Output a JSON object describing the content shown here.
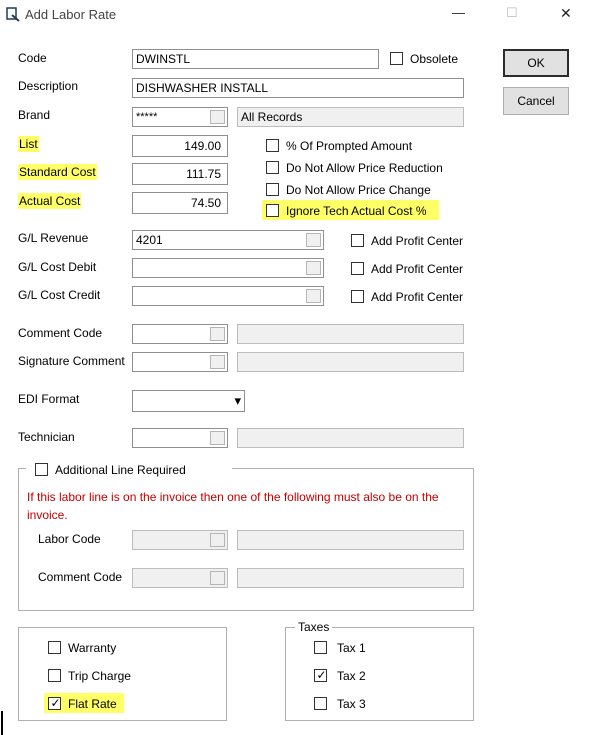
{
  "window": {
    "title": "Add Labor Rate",
    "controls": {
      "minimize": "—",
      "maximize": "☐",
      "close": "✕"
    }
  },
  "buttons": {
    "ok": "OK",
    "cancel": "Cancel"
  },
  "fields": {
    "code": {
      "label": "Code",
      "value": "DWINSTL"
    },
    "obsolete": {
      "label": "Obsolete",
      "checked": false
    },
    "description": {
      "label": "Description",
      "value": "DISHWASHER INSTALL"
    },
    "brand": {
      "label": "Brand",
      "value": "*****",
      "display": "All Records"
    },
    "list": {
      "label": "List",
      "value": "149.00"
    },
    "standard_cost": {
      "label": "Standard Cost",
      "value": "111.75"
    },
    "actual_cost": {
      "label": "Actual Cost",
      "value": "74.50"
    },
    "gl_revenue": {
      "label": "G/L Revenue",
      "value": "4201"
    },
    "gl_cost_debit": {
      "label": "G/L Cost Debit",
      "value": ""
    },
    "gl_cost_credit": {
      "label": "G/L Cost Credit",
      "value": ""
    },
    "comment_code": {
      "label": "Comment Code",
      "value": "",
      "display": ""
    },
    "signature_comment": {
      "label": "Signature Comment",
      "value": "",
      "display": ""
    },
    "edi_format": {
      "label": "EDI Format",
      "value": ""
    },
    "technician": {
      "label": "Technician",
      "value": "",
      "display": ""
    }
  },
  "price_options": {
    "prompted_amount": {
      "label": "% Of Prompted Amount",
      "checked": false
    },
    "no_price_reduction": {
      "label": "Do Not Allow Price Reduction",
      "checked": false
    },
    "no_price_change": {
      "label": "Do Not Allow Price Change",
      "checked": false
    },
    "ignore_tech_cost": {
      "label": "Ignore Tech Actual Cost %",
      "checked": false
    }
  },
  "profit_center": {
    "label": "Add Profit Center"
  },
  "additional_line": {
    "label": "Additional Line Required",
    "checked": false,
    "note": "If this labor line is on the invoice then one of the following must also be on the invoice.",
    "labor_code_label": "Labor Code",
    "comment_code_label": "Comment Code"
  },
  "flags": {
    "warranty": {
      "label": "Warranty",
      "checked": false
    },
    "trip_charge": {
      "label": "Trip Charge",
      "checked": false
    },
    "flat_rate": {
      "label": "Flat Rate",
      "checked": true
    }
  },
  "taxes": {
    "title": "Taxes",
    "tax1": {
      "label": "Tax 1",
      "checked": false
    },
    "tax2": {
      "label": "Tax 2",
      "checked": true
    },
    "tax3": {
      "label": "Tax 3",
      "checked": false
    }
  },
  "glyphs": {
    "check": "✓",
    "dropdown": "▾"
  },
  "highlight_color": "#ffff66",
  "note_color": "#c00000"
}
